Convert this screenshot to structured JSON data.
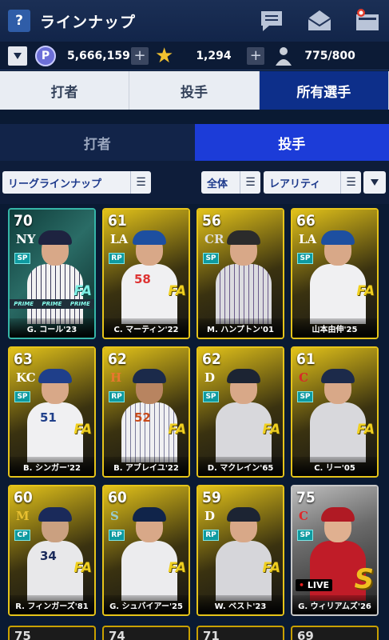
{
  "header": {
    "title": "ラインナップ",
    "help_label": "?"
  },
  "currency": {
    "points": "5,666,159",
    "stars": "1,294",
    "roster": "775/800",
    "p_label": "P"
  },
  "main_tabs": [
    {
      "label": "打者"
    },
    {
      "label": "投手"
    },
    {
      "label": "所有選手"
    }
  ],
  "sub_tabs": [
    {
      "label": "打者"
    },
    {
      "label": "投手"
    }
  ],
  "filters": {
    "league": "リーグラインナップ",
    "scope": "全体",
    "rarity": "レアリティ"
  },
  "cards": [
    {
      "rating": "70",
      "team": "NY",
      "pos": "SP",
      "name": "G. コール'23",
      "kind": "prime",
      "prime_label": "PRIME"
    },
    {
      "rating": "61",
      "team": "LA",
      "pos": "RP",
      "name": "C. マーティン'22",
      "kind": "fa",
      "number": "58",
      "fa": "FA"
    },
    {
      "rating": "56",
      "team": "CR",
      "pos": "SP",
      "name": "M. ハンプトン'01",
      "kind": "fa",
      "fa": ""
    },
    {
      "rating": "66",
      "team": "LA",
      "pos": "SP",
      "name": "山本由伸'25",
      "kind": "fa",
      "fa": "FA"
    },
    {
      "rating": "63",
      "team": "KC",
      "pos": "SP",
      "name": "B. シンガー'22",
      "kind": "fa",
      "number": "51",
      "fa": "FA"
    },
    {
      "rating": "62",
      "team": "H",
      "pos": "RP",
      "name": "B. アブレイユ'22",
      "kind": "fa",
      "number": "52",
      "fa": "FA"
    },
    {
      "rating": "62",
      "team": "D",
      "pos": "SP",
      "name": "D. マクレイン'65",
      "kind": "fa",
      "fa": "FA"
    },
    {
      "rating": "61",
      "team": "C",
      "pos": "SP",
      "name": "C. リー'05",
      "kind": "fa",
      "fa": "FA"
    },
    {
      "rating": "60",
      "team": "M",
      "pos": "CP",
      "name": "R. フィンガーズ'81",
      "kind": "fa",
      "number": "34",
      "fa": "FA"
    },
    {
      "rating": "60",
      "team": "S",
      "pos": "RP",
      "name": "G. シュバイアー'25",
      "kind": "fa",
      "fa": "FA"
    },
    {
      "rating": "59",
      "team": "D",
      "pos": "RP",
      "name": "W. ベスト'23",
      "kind": "fa",
      "fa": "FA"
    },
    {
      "rating": "75",
      "team": "C",
      "pos": "SP",
      "name": "G. ウィリアムズ'26",
      "kind": "live",
      "live_label": "LIVE",
      "big": "S"
    }
  ],
  "peek": [
    "75",
    "74",
    "71",
    "69"
  ],
  "colors": {
    "accent": "#1c3cd8",
    "tab_active": "#0d2f8a",
    "card_gold": "#e6c419",
    "prime_teal": "#35b6a8",
    "pos_badge": "#0e9aa0"
  }
}
